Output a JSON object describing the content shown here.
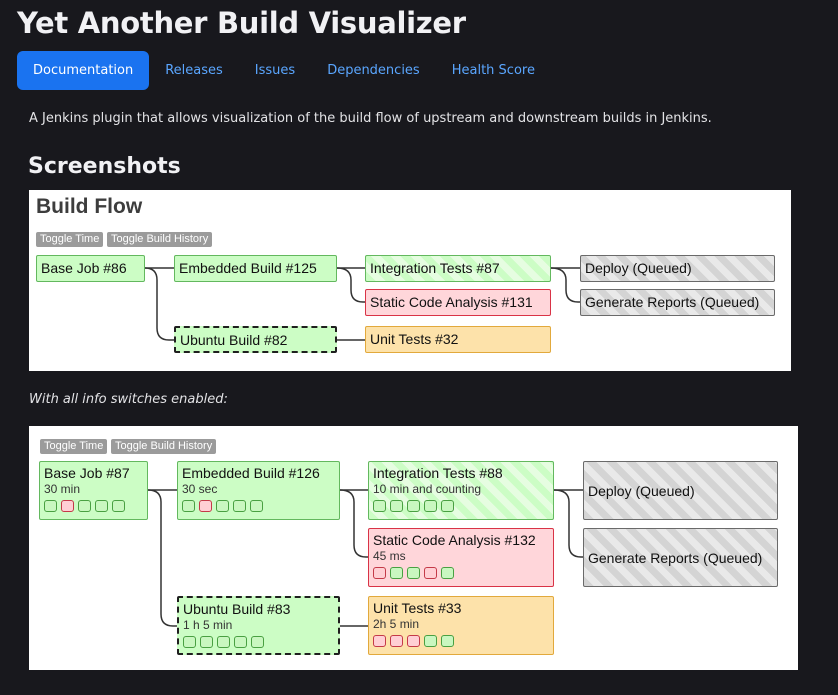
{
  "page": {
    "title": "Yet Another Build Visualizer",
    "intro": "A Jenkins plugin that allows visualization of the build flow of upstream and downstream builds in Jenkins.",
    "screenshots_heading": "Screenshots",
    "caption": "With all info switches enabled:"
  },
  "nav": {
    "tabs": [
      "Documentation",
      "Releases",
      "Issues",
      "Dependencies",
      "Health Score"
    ],
    "active": "Documentation"
  },
  "colors": {
    "background": "#18181d",
    "accent": "#1a73f0",
    "link": "#5aa6ff",
    "success": "#ccfdc5",
    "failure": "#ffd6da",
    "unstable": "#fde2aa",
    "queued": "#d4d4d4"
  },
  "screenshot1": {
    "title": "Build Flow",
    "toggle_time": "Toggle Time",
    "toggle_history": "Toggle Build History",
    "nodes": {
      "base": "Base Job #86",
      "embedded": "Embedded Build #125",
      "ubuntu": "Ubuntu Build #82",
      "integration": "Integration Tests #87",
      "static": "Static Code Analysis #131",
      "unit": "Unit Tests #32",
      "deploy": "Deploy (Queued)",
      "reports": "Generate Reports (Queued)"
    }
  },
  "screenshot2": {
    "toggle_time": "Toggle Time",
    "toggle_history": "Toggle Build History",
    "nodes": {
      "base": {
        "label": "Base Job #87",
        "time": "30 min",
        "history": [
          "success",
          "failure",
          "success",
          "success",
          "success"
        ]
      },
      "embedded": {
        "label": "Embedded Build #126",
        "time": "30 sec",
        "history": [
          "success",
          "failure",
          "success",
          "success",
          "success"
        ]
      },
      "ubuntu": {
        "label": "Ubuntu Build #83",
        "time": "1 h 5 min",
        "history": [
          "success",
          "success",
          "success",
          "success",
          "success"
        ]
      },
      "integration": {
        "label": "Integration Tests #88",
        "time": "10 min and counting",
        "history": [
          "success",
          "success",
          "success",
          "success",
          "success"
        ]
      },
      "static": {
        "label": "Static Code Analysis #132",
        "time": "45 ms",
        "history": [
          "failure",
          "success",
          "success",
          "failure",
          "success"
        ]
      },
      "unit": {
        "label": "Unit Tests #33",
        "time": "2h 5 min",
        "history": [
          "failure",
          "failure",
          "failure",
          "success",
          "success"
        ]
      },
      "deploy": {
        "label": "Deploy (Queued)"
      },
      "reports": {
        "label": "Generate Reports (Queued)"
      }
    }
  }
}
